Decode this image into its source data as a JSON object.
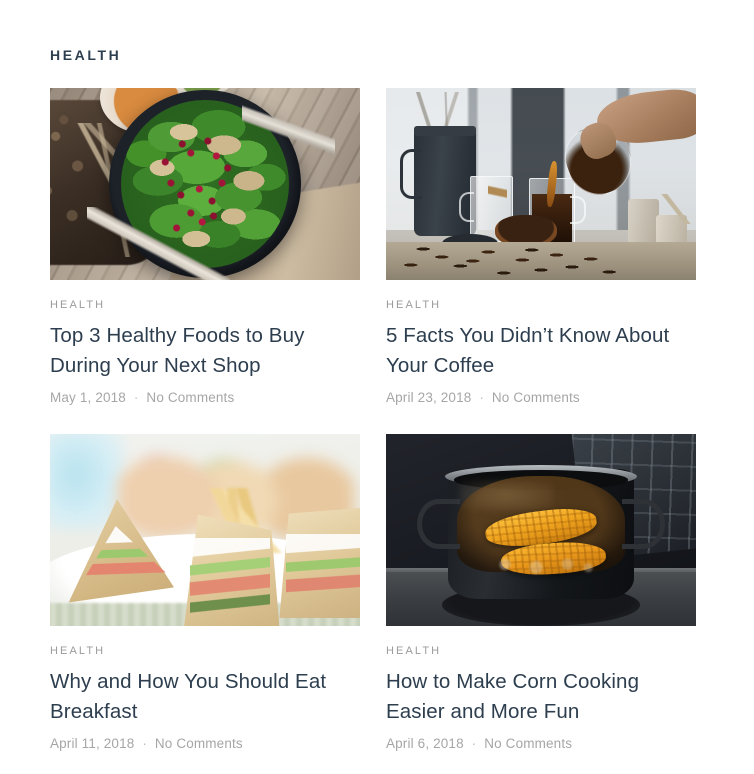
{
  "section": {
    "heading": "HEALTH"
  },
  "posts": [
    {
      "category": "HEALTH",
      "title": "Top 3 Healthy Foods to Buy During Your Next Shop",
      "date": "May 1, 2018",
      "separator": "·",
      "comments": "No Comments",
      "image_alt": "spinach-salad-bowl"
    },
    {
      "category": "HEALTH",
      "title": "5 Facts You Didn’t Know About Your Coffee",
      "date": "April 23, 2018",
      "separator": "·",
      "comments": "No Comments",
      "image_alt": "pouring-coffee-into-glass"
    },
    {
      "category": "HEALTH",
      "title": "Why and How You Should Eat Breakfast",
      "date": "April 11, 2018",
      "separator": "·",
      "comments": "No Comments",
      "image_alt": "club-sandwiches-on-plate"
    },
    {
      "category": "HEALTH",
      "title": "How to Make Corn Cooking Easier and More Fun",
      "date": "April 6, 2018",
      "separator": "·",
      "comments": "No Comments",
      "image_alt": "corn-boiling-in-pot"
    }
  ],
  "colors": {
    "page_background": "#ffffff",
    "heading": "#2e3f50",
    "title": "#2d3e4f",
    "category": "#9b9b9b",
    "meta": "#a6a6a6"
  }
}
